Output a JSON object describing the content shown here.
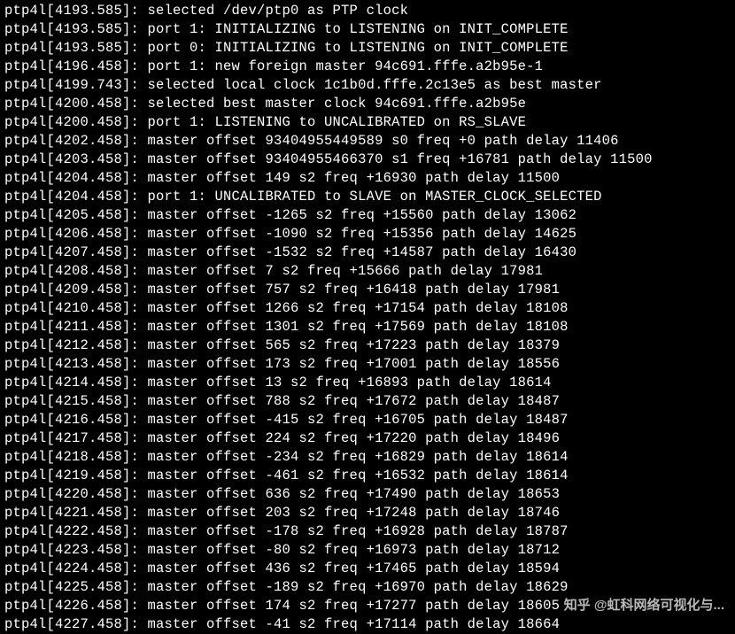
{
  "program": "ptp4l",
  "watermark": "知乎 @虹科网络可视化与...",
  "messages": [
    {
      "ts": "4193.585",
      "text": "selected /dev/ptp0 as PTP clock"
    },
    {
      "ts": "4193.585",
      "text": "port 1: INITIALIZING to LISTENING on INIT_COMPLETE"
    },
    {
      "ts": "4193.585",
      "text": "port 0: INITIALIZING to LISTENING on INIT_COMPLETE"
    },
    {
      "ts": "4196.458",
      "text": "port 1: new foreign master 94c691.fffe.a2b95e-1"
    },
    {
      "ts": "4199.743",
      "text": "selected local clock 1c1b0d.fffe.2c13e5 as best master"
    },
    {
      "ts": "4200.458",
      "text": "selected best master clock 94c691.fffe.a2b95e"
    },
    {
      "ts": "4200.458",
      "text": "port 1: LISTENING to UNCALIBRATED on RS_SLAVE"
    }
  ],
  "offsets": [
    {
      "ts": "4202.458",
      "offset": "93404955449589",
      "state": "s0",
      "freq": "+0",
      "delay": "11406"
    },
    {
      "ts": "4203.458",
      "offset": "93404955466370",
      "state": "s1",
      "freq": "+16781",
      "delay": "11500"
    },
    {
      "ts": "4204.458",
      "offset": "149",
      "state": "s2",
      "freq": "+16930",
      "delay": "11500"
    }
  ],
  "midmessage": {
    "ts": "4204.458",
    "text": "port 1: UNCALIBRATED to SLAVE on MASTER_CLOCK_SELECTED"
  },
  "offsets2": [
    {
      "ts": "4205.458",
      "offset": "-1265",
      "state": "s2",
      "freq": "+15560",
      "delay": "13062"
    },
    {
      "ts": "4206.458",
      "offset": "-1090",
      "state": "s2",
      "freq": "+15356",
      "delay": "14625"
    },
    {
      "ts": "4207.458",
      "offset": "-1532",
      "state": "s2",
      "freq": "+14587",
      "delay": "16430"
    },
    {
      "ts": "4208.458",
      "offset": "7",
      "state": "s2",
      "freq": "+15666",
      "delay": "17981"
    },
    {
      "ts": "4209.458",
      "offset": "757",
      "state": "s2",
      "freq": "+16418",
      "delay": "17981"
    },
    {
      "ts": "4210.458",
      "offset": "1266",
      "state": "s2",
      "freq": "+17154",
      "delay": "18108"
    },
    {
      "ts": "4211.458",
      "offset": "1301",
      "state": "s2",
      "freq": "+17569",
      "delay": "18108"
    },
    {
      "ts": "4212.458",
      "offset": "565",
      "state": "s2",
      "freq": "+17223",
      "delay": "18379"
    },
    {
      "ts": "4213.458",
      "offset": "173",
      "state": "s2",
      "freq": "+17001",
      "delay": "18556"
    },
    {
      "ts": "4214.458",
      "offset": "13",
      "state": "s2",
      "freq": "+16893",
      "delay": "18614"
    },
    {
      "ts": "4215.458",
      "offset": "788",
      "state": "s2",
      "freq": "+17672",
      "delay": "18487"
    },
    {
      "ts": "4216.458",
      "offset": "-415",
      "state": "s2",
      "freq": "+16705",
      "delay": "18487"
    },
    {
      "ts": "4217.458",
      "offset": "224",
      "state": "s2",
      "freq": "+17220",
      "delay": "18496"
    },
    {
      "ts": "4218.458",
      "offset": "-234",
      "state": "s2",
      "freq": "+16829",
      "delay": "18614"
    },
    {
      "ts": "4219.458",
      "offset": "-461",
      "state": "s2",
      "freq": "+16532",
      "delay": "18614"
    },
    {
      "ts": "4220.458",
      "offset": "636",
      "state": "s2",
      "freq": "+17490",
      "delay": "18653"
    },
    {
      "ts": "4221.458",
      "offset": "203",
      "state": "s2",
      "freq": "+17248",
      "delay": "18746"
    },
    {
      "ts": "4222.458",
      "offset": "-178",
      "state": "s2",
      "freq": "+16928",
      "delay": "18787"
    },
    {
      "ts": "4223.458",
      "offset": "-80",
      "state": "s2",
      "freq": "+16973",
      "delay": "18712"
    },
    {
      "ts": "4224.458",
      "offset": "436",
      "state": "s2",
      "freq": "+17465",
      "delay": "18594"
    },
    {
      "ts": "4225.458",
      "offset": "-189",
      "state": "s2",
      "freq": "+16970",
      "delay": "18629"
    },
    {
      "ts": "4226.458",
      "offset": "174",
      "state": "s2",
      "freq": "+17277",
      "delay": "18605"
    },
    {
      "ts": "4227.458",
      "offset": "-41",
      "state": "s2",
      "freq": "+17114",
      "delay": "18664"
    }
  ]
}
